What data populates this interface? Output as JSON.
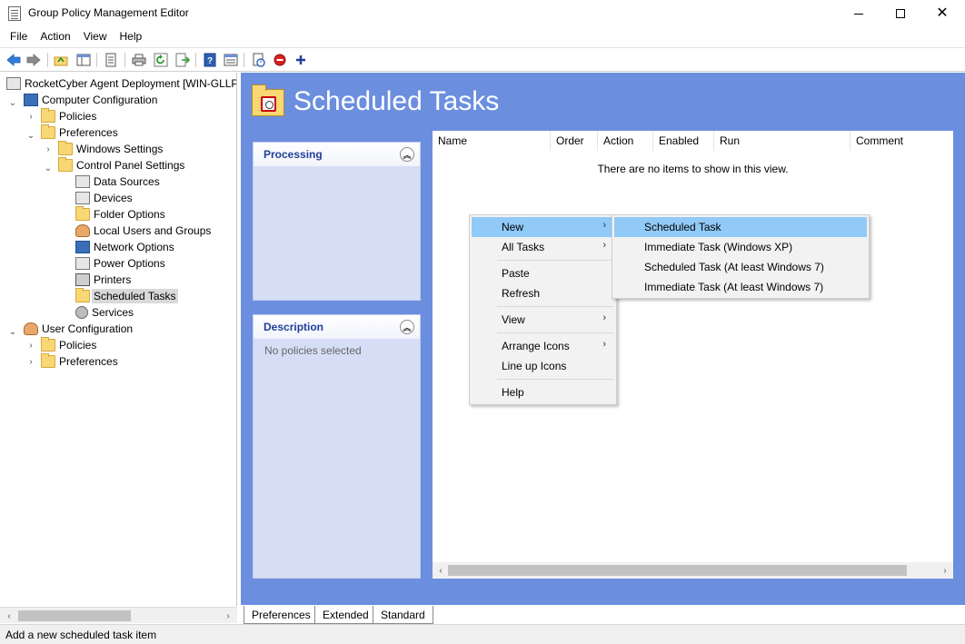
{
  "window": {
    "title": "Group Policy Management Editor",
    "controls": {
      "minimize": "—",
      "maximize": "☐",
      "close": "✕"
    }
  },
  "menubar": {
    "items": [
      "File",
      "Action",
      "View",
      "Help"
    ]
  },
  "toolbar": {
    "buttons": [
      "back-arrow-icon",
      "forward-arrow-icon",
      "up-folder-icon",
      "show-hide-tree-icon",
      "properties-icon",
      "print-icon",
      "refresh-icon",
      "export-list-icon",
      "help-icon",
      "view-icon",
      "show-sync-icon",
      "stop-icon",
      "add-icon"
    ]
  },
  "tree": {
    "root": "RocketCyber Agent Deployment [WIN-GLLP",
    "computer_config": "Computer Configuration",
    "cc_policies": "Policies",
    "cc_preferences": "Preferences",
    "windows_settings": "Windows Settings",
    "control_panel_settings": "Control Panel Settings",
    "data_sources": "Data Sources",
    "devices": "Devices",
    "folder_options": "Folder Options",
    "local_users_groups": "Local Users and Groups",
    "network_options": "Network Options",
    "power_options": "Power Options",
    "printers": "Printers",
    "scheduled_tasks": "Scheduled Tasks",
    "services": "Services",
    "user_config": "User Configuration",
    "uc_policies": "Policies",
    "uc_preferences": "Preferences"
  },
  "main": {
    "title": "Scheduled Tasks",
    "processing": {
      "header": "Processing"
    },
    "description": {
      "header": "Description",
      "body": "No policies selected"
    },
    "columns": [
      "Name",
      "Order",
      "Action",
      "Enabled",
      "Run",
      "Comment"
    ],
    "empty_message": "There are no items to show in this view."
  },
  "context_menu": {
    "new": "New",
    "all_tasks": "All Tasks",
    "paste": "Paste",
    "refresh": "Refresh",
    "view": "View",
    "arrange_icons": "Arrange Icons",
    "line_up_icons": "Line up Icons",
    "help": "Help"
  },
  "submenu": {
    "scheduled_task": "Scheduled Task",
    "immediate_task_xp": "Immediate Task (Windows XP)",
    "scheduled_task_win7": "Scheduled Task (At least Windows 7)",
    "immediate_task_win7": "Immediate Task (At least Windows 7)"
  },
  "tabs": {
    "preferences": "Preferences",
    "extended": "Extended",
    "standard": "Standard"
  },
  "status": {
    "text": "Add a new scheduled task item"
  }
}
